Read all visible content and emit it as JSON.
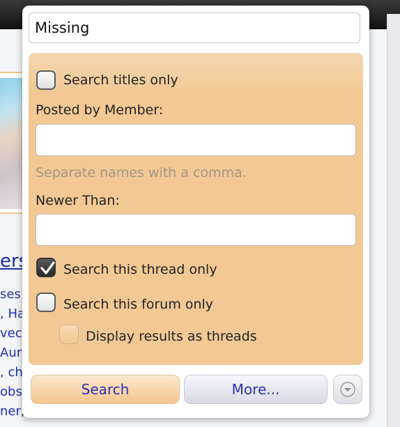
{
  "search_popup": {
    "query_value": "Missing",
    "titles_only_label": "Search titles only",
    "posted_by_label": "Posted by Member:",
    "posted_by_value": "",
    "posted_by_hint": "Separate names with a comma.",
    "newer_than_label": "Newer Than:",
    "newer_than_value": "",
    "thread_only_label": "Search this thread only",
    "forum_only_label": "Search this forum only",
    "display_threads_label": "Display results as threads",
    "search_button": "Search",
    "more_button": "More...",
    "checkbox_states": {
      "titles_only": false,
      "thread_only": true,
      "forum_only": false,
      "display_threads": false
    }
  },
  "background": {
    "heading_fragment": "ers",
    "link_fragments": [
      "ses",
      ", Ha",
      "vec",
      "Aur",
      ", ch",
      "obs",
      "ner,"
    ]
  },
  "colors": {
    "panel": "#f2c894",
    "link": "#2b2fb5",
    "topbar": "#1a1a1a"
  }
}
